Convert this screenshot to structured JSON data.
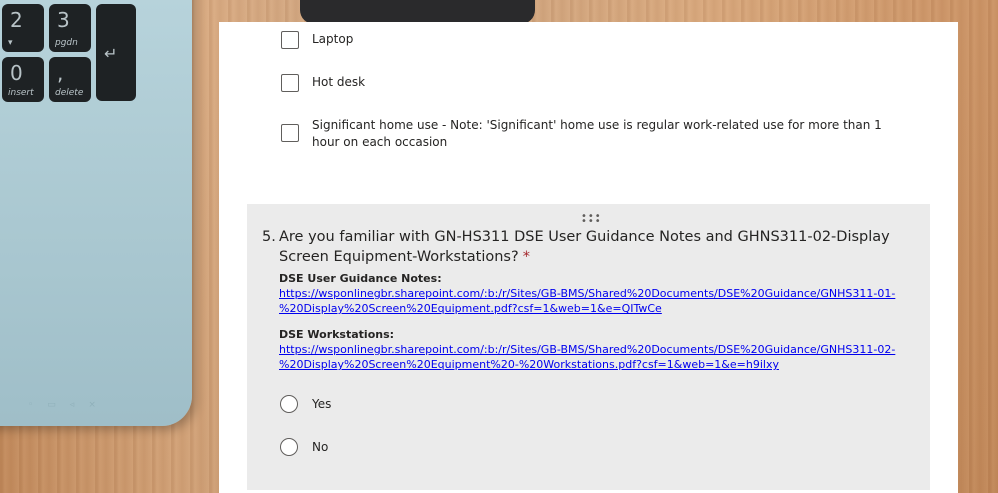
{
  "keyboard": {
    "keys": [
      {
        "big": "2",
        "small": "▾"
      },
      {
        "big": "3",
        "small": "pgdn"
      },
      {
        "big": "0",
        "small": "insert"
      },
      {
        "big": ",",
        "small": "delete"
      }
    ]
  },
  "options": [
    {
      "label": "Laptop"
    },
    {
      "label": "Hot desk"
    },
    {
      "label": "Significant home use - Note: 'Significant' home use is regular work-related use for more than 1 hour on each occasion"
    }
  ],
  "question": {
    "number": "5.",
    "text": "Are you familiar with GN-HS311 DSE User Guidance Notes and GHNS311-02-Display Screen Equipment-Workstations?",
    "required_mark": "*",
    "guidance_heading": "DSE User Guidance Notes:",
    "guidance_link": "https://wsponlinegbr.sharepoint.com/:b:/r/Sites/GB-BMS/Shared%20Documents/DSE%20Guidance/GNHS311-01-%20Display%20Screen%20Equipment.pdf?csf=1&web=1&e=QITwCe",
    "workstations_heading": "DSE Workstations:",
    "workstations_link": "https://wsponlinegbr.sharepoint.com/:b:/r/Sites/GB-BMS/Shared%20Documents/DSE%20Guidance/GNHS311-02-%20Display%20Screen%20Equipment%20-%20Workstations.pdf?csf=1&web=1&e=h9ilxy",
    "choices": [
      {
        "label": "Yes"
      },
      {
        "label": "No"
      }
    ]
  },
  "colors": {
    "required": "#a4262c",
    "link": "#0000ee",
    "question_bg": "#ebebeb"
  }
}
